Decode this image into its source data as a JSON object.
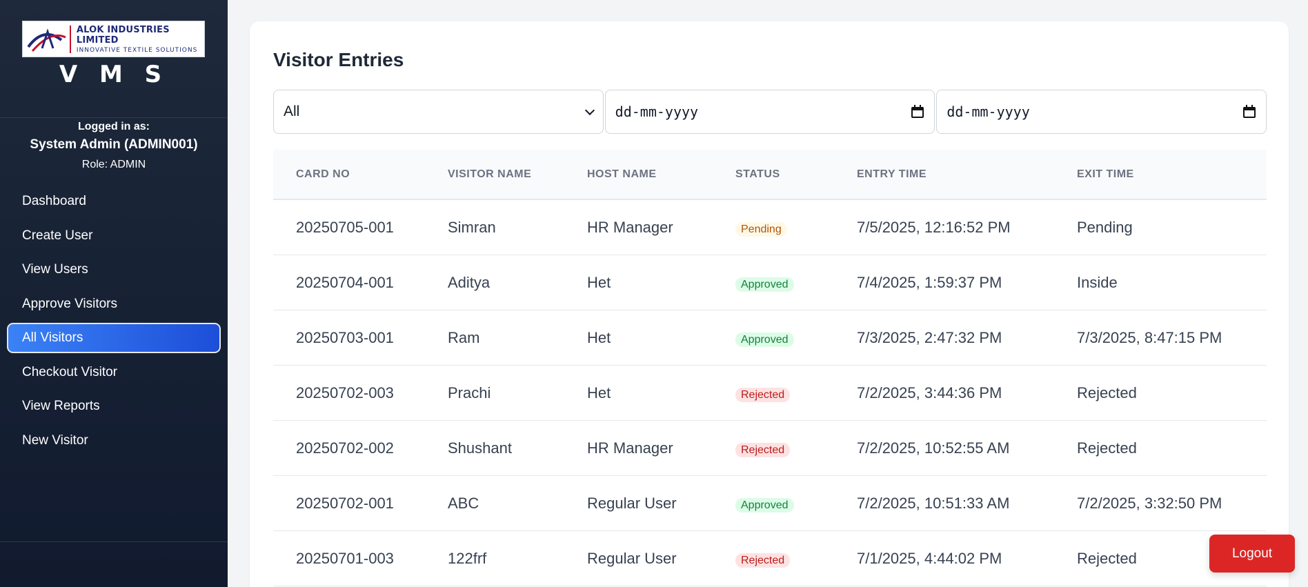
{
  "sidebar": {
    "logo": {
      "title": "ALOK INDUSTRIES LIMITED",
      "subtitle": "INNOVATIVE TEXTILE SOLUTIONS"
    },
    "app_name": "V M S",
    "user": {
      "logged_label": "Logged in as:",
      "name": "System Admin (ADMIN001)",
      "role": "Role: ADMIN"
    },
    "nav": [
      {
        "label": "Dashboard",
        "active": false
      },
      {
        "label": "Create User",
        "active": false
      },
      {
        "label": "View Users",
        "active": false
      },
      {
        "label": "Approve Visitors",
        "active": false
      },
      {
        "label": "All Visitors",
        "active": true
      },
      {
        "label": "Checkout Visitor",
        "active": false
      },
      {
        "label": "View Reports",
        "active": false
      },
      {
        "label": "New Visitor",
        "active": false
      }
    ]
  },
  "main": {
    "title": "Visitor Entries",
    "filters": {
      "status_value": "All",
      "from_date_placeholder": "dd-mm-yyyy",
      "to_date_placeholder": "dd-mm-yyyy"
    },
    "table": {
      "headers": [
        "CARD NO",
        "VISITOR NAME",
        "HOST NAME",
        "STATUS",
        "ENTRY TIME",
        "EXIT TIME"
      ],
      "rows": [
        [
          "20250705-001",
          "Simran",
          "HR Manager",
          "Pending",
          "7/5/2025, 12:16:52 PM",
          "Pending"
        ],
        [
          "20250704-001",
          "Aditya",
          "Het",
          "Approved",
          "7/4/2025, 1:59:37 PM",
          "Inside"
        ],
        [
          "20250703-001",
          "Ram",
          "Het",
          "Approved",
          "7/3/2025, 2:47:32 PM",
          "7/3/2025, 8:47:15 PM"
        ],
        [
          "20250702-003",
          "Prachi",
          "Het",
          "Rejected",
          "7/2/2025, 3:44:36 PM",
          "Rejected"
        ],
        [
          "20250702-002",
          "Shushant",
          "HR Manager",
          "Rejected",
          "7/2/2025, 10:52:55 AM",
          "Rejected"
        ],
        [
          "20250702-001",
          "ABC",
          "Regular User",
          "Approved",
          "7/2/2025, 10:51:33 AM",
          "7/2/2025, 3:32:50 PM"
        ],
        [
          "20250701-003",
          "122frf",
          "Regular User",
          "Rejected",
          "7/1/2025, 4:44:02 PM",
          "Rejected"
        ]
      ]
    }
  },
  "logout_label": "Logout",
  "colors": {
    "accent": "#2563eb",
    "logout": "#dc2626",
    "sidebar": "#1e293b"
  }
}
